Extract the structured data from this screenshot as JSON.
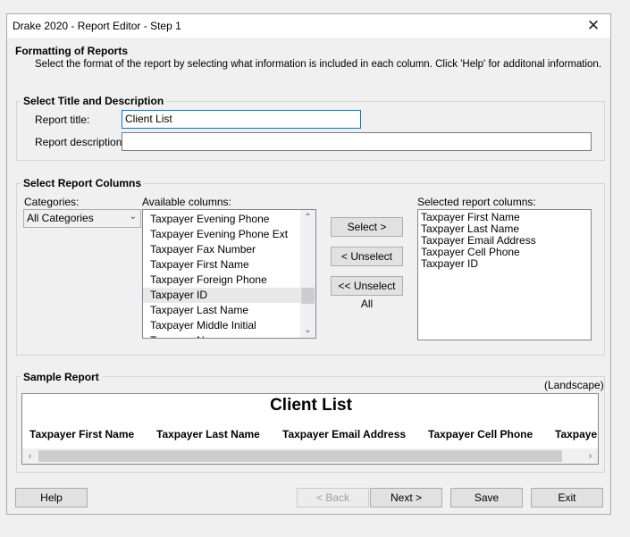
{
  "window": {
    "title": "Drake 2020 - Report Editor - Step 1",
    "close_glyph": "✕"
  },
  "header": {
    "heading": "Formatting of Reports",
    "instructions": "Select the format of the report by selecting what information is included in each column. Click 'Help' for additonal information."
  },
  "title_group": {
    "label": "Select Title and Description",
    "report_title_label": "Report title:",
    "report_title_value": "Client List",
    "report_description_label": "Report description:",
    "report_description_value": ""
  },
  "columns_group": {
    "label": "Select Report Columns",
    "categories_label": "Categories:",
    "categories_value": "All Categories",
    "available_label": "Available columns:",
    "available_items": [
      "Taxpayer Evening Phone",
      "Taxpayer Evening Phone Ext",
      "Taxpayer Fax Number",
      "Taxpayer First Name",
      "Taxpayer Foreign Phone",
      "Taxpayer ID",
      "Taxpayer Last Name",
      "Taxpayer Middle Initial",
      "Taxpayer N..."
    ],
    "selected_available_item": "Taxpayer ID",
    "select_button": "Select >",
    "unselect_button": "< Unselect",
    "unselect_all_button": "<< Unselect All",
    "selected_label": "Selected report columns:",
    "selected_items": [
      "Taxpayer First Name",
      "Taxpayer Last Name",
      "Taxpayer Email Address",
      "Taxpayer Cell Phone",
      "Taxpayer ID"
    ]
  },
  "sample": {
    "label": "Sample Report",
    "orientation": "(Landscape)",
    "report_title": "Client List",
    "columns": [
      "Taxpayer First Name",
      "Taxpayer Last Name",
      "Taxpayer Email Address",
      "Taxpayer Cell Phone",
      "Taxpaye"
    ]
  },
  "footer": {
    "help": "Help",
    "back": "< Back",
    "next": "Next >",
    "save": "Save",
    "exit": "Exit"
  },
  "colors": {
    "focus_border": "#0078d7",
    "window_bg": "#f0f0f0"
  }
}
